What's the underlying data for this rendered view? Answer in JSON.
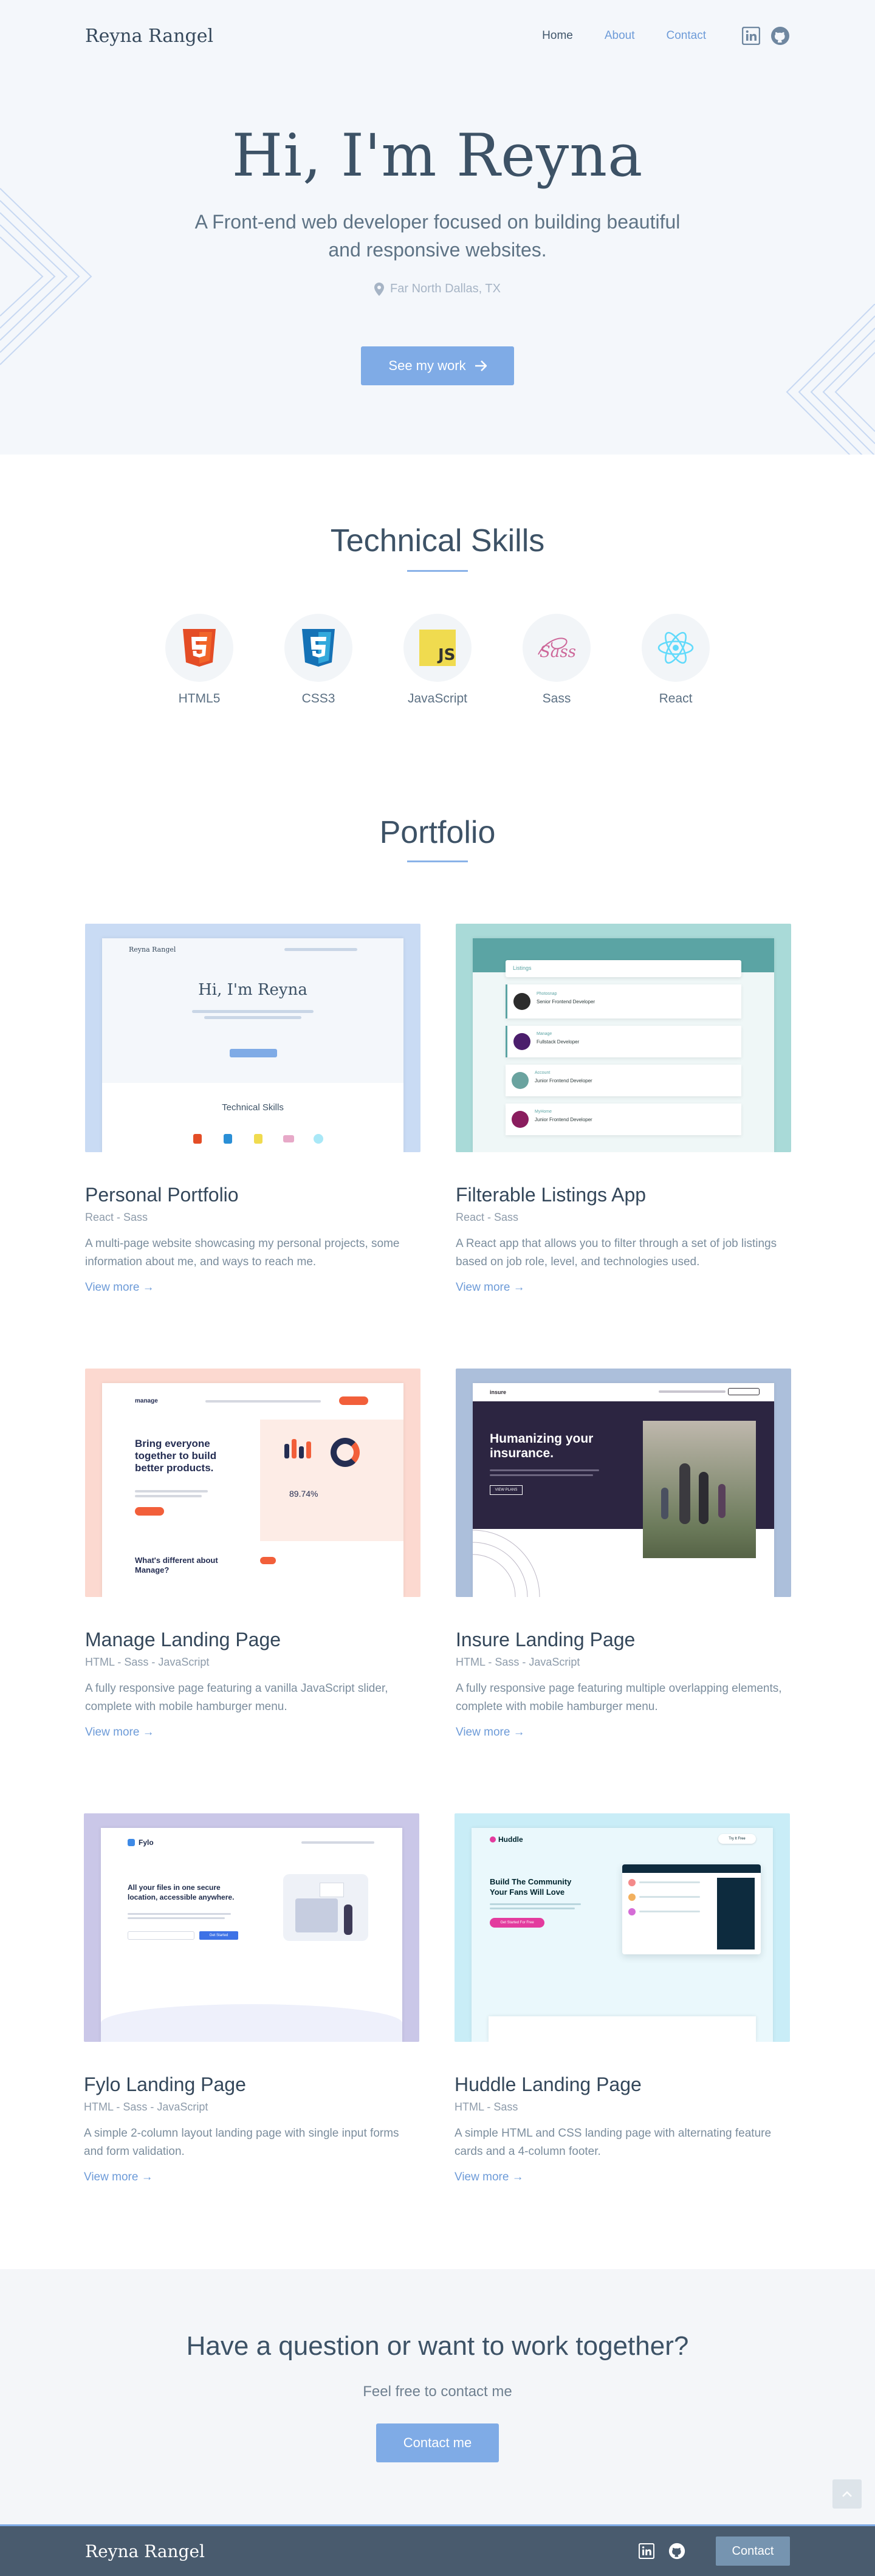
{
  "header": {
    "brand": "Reyna Rangel",
    "nav": [
      {
        "label": "Home",
        "active": true
      },
      {
        "label": "About",
        "active": false
      },
      {
        "label": "Contact",
        "active": false
      }
    ],
    "icons": [
      "linkedin-icon",
      "github-icon"
    ]
  },
  "hero": {
    "title": "Hi, I'm Reyna",
    "tagline": "A Front-end web developer focused on building beautiful and responsive websites.",
    "location": "Far North Dallas, TX",
    "cta": "See my work"
  },
  "skills": {
    "title": "Technical Skills",
    "items": [
      {
        "name": "HTML5",
        "icon": "html5-icon",
        "color": "#e44d26"
      },
      {
        "name": "CSS3",
        "icon": "css3-icon",
        "color": "#2a8fd6"
      },
      {
        "name": "JavaScript",
        "icon": "javascript-icon",
        "color": "#f0db4f"
      },
      {
        "name": "Sass",
        "icon": "sass-icon",
        "color": "#cd6799"
      },
      {
        "name": "React",
        "icon": "react-icon",
        "color": "#61dafb"
      }
    ]
  },
  "portfolio": {
    "title": "Portfolio",
    "projects": [
      {
        "title": "Personal Portfolio",
        "tech": "React - Sass",
        "desc": "A multi-page website showcasing my personal projects, some information about me, and ways to reach me.",
        "link": "View more"
      },
      {
        "title": "Filterable Listings App",
        "tech": "React - Sass",
        "desc": "A React app that allows you to filter through a set of job listings based on job role, level, and technologies used.",
        "link": "View more"
      },
      {
        "title": "Manage Landing Page",
        "tech": "HTML - Sass - JavaScript",
        "desc": "A fully responsive page featuring a vanilla JavaScript slider, complete with mobile hamburger menu.",
        "link": "View more"
      },
      {
        "title": "Insure Landing Page",
        "tech": "HTML - Sass - JavaScript",
        "desc": "A fully responsive page featuring multiple overlapping elements, complete with mobile hamburger menu.",
        "link": "View more"
      },
      {
        "title": "Fylo Landing Page",
        "tech": "HTML - Sass - JavaScript",
        "desc": "A simple 2-column layout landing page with single input forms and form validation.",
        "link": "View more"
      },
      {
        "title": "Huddle Landing Page",
        "tech": "HTML - Sass",
        "desc": "A simple HTML and CSS landing page with alternating feature cards and a 4-column footer.",
        "link": "View more"
      }
    ],
    "thumb_text": {
      "portfolio_brand": "Reyna Rangel",
      "portfolio_hero": "Hi, I'm Reyna",
      "portfolio_skills": "Technical Skills",
      "listings_brand": "Listings",
      "listings_company_1": "Photosnap",
      "listings_company_2": "Manage",
      "listings_company_3": "Account",
      "listings_company_4": "MyHome",
      "listings_role_1": "Senior Frontend Developer",
      "listings_role_2": "Fullstack Developer",
      "listings_role_3": "Junior Frontend Developer",
      "listings_role_4": "Junior Frontend Developer",
      "manage_brand": "manage",
      "manage_heading": "Bring everyone together to build better products.",
      "manage_stat": "89.74%",
      "manage_sub": "What's different about Manage?",
      "insure_brand": "insure",
      "insure_heading": "Humanizing your insurance.",
      "insure_btn": "VIEW PLANS",
      "fylo_brand": "Fylo",
      "fylo_heading": "All your files in one secure location, accessible anywhere.",
      "fylo_btn": "Get Started",
      "huddle_brand": "Huddle",
      "huddle_heading": "Build The Community Your Fans Will Love",
      "huddle_btn": "Get Started For Free",
      "huddle_nav_btn": "Try It Free"
    }
  },
  "contact": {
    "title": "Have a question or want to work together?",
    "subtitle": "Feel free to contact me",
    "cta": "Contact me"
  },
  "footer": {
    "brand": "Reyna Rangel",
    "cta": "Contact"
  },
  "colors": {
    "accent": "#7fabe6",
    "heading": "#3d5266",
    "footer_bg": "#495b6e"
  }
}
